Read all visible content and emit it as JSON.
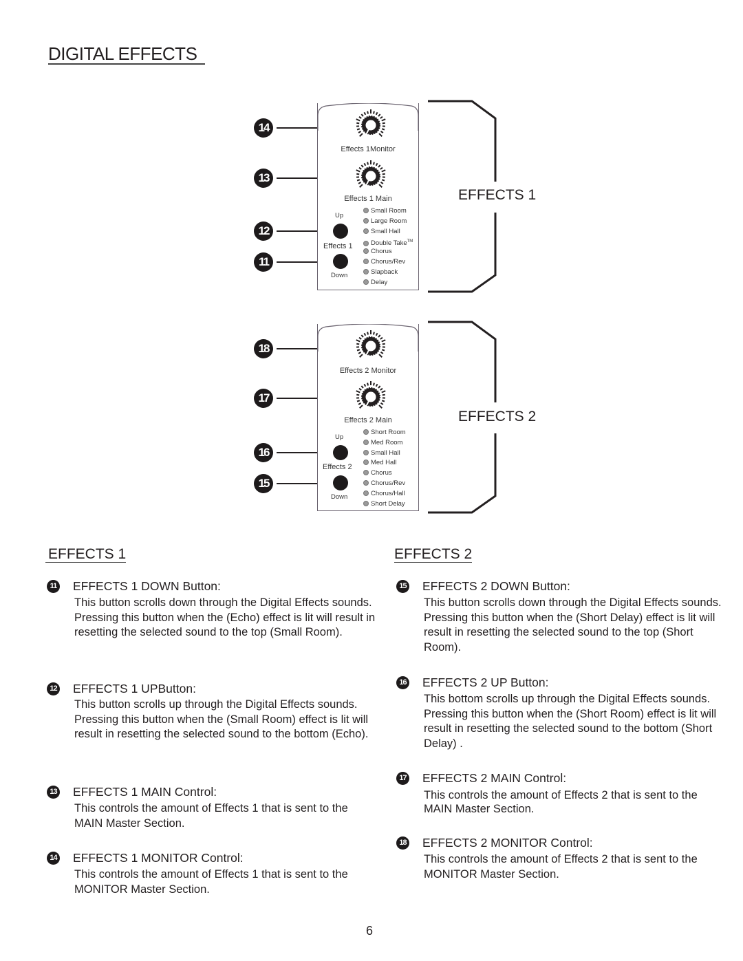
{
  "page": {
    "title": "DIGITAL EFFECTS",
    "page_number": "6"
  },
  "diagram": {
    "effects1": {
      "bracket_label": "EFFECTS 1",
      "monitor_knob_label": "Effects 1Monitor",
      "main_knob_label": "Effects 1 Main",
      "up_label": "Up",
      "down_label": "Down",
      "group_label": "Effects 1",
      "callouts": {
        "monitor": "14",
        "main": "13",
        "up": "12",
        "down": "11"
      },
      "effects": [
        "Small Room",
        "Large Room",
        "Small Hall",
        "Double Take",
        "Chorus",
        "Chorus/Rev",
        "Slapback",
        "Delay"
      ],
      "trademark": "TM"
    },
    "effects2": {
      "bracket_label": "EFFECTS 2",
      "monitor_knob_label": "Effects 2 Monitor",
      "main_knob_label": "Effects 2 Main",
      "up_label": "Up",
      "down_label": "Down",
      "group_label": "Effects 2",
      "callouts": {
        "monitor": "18",
        "main": "17",
        "up": "16",
        "down": "15"
      },
      "effects": [
        "Short Room",
        "Med Room",
        "Small Hall",
        "Med Hall",
        "Chorus",
        "Chorus/Rev",
        "Chorus/Hall",
        "Short Delay"
      ]
    }
  },
  "sections": {
    "effects1": {
      "heading": "EFFECTS 1",
      "items": [
        {
          "num": "11",
          "title": "EFFECTS 1 DOWN Button:",
          "desc": "This button scrolls down through the Digital Effects sounds.  Pressing this button when the (Echo) effect is lit will result in resetting the selected sound to the top (Small Room)."
        },
        {
          "num": "12",
          "title": "EFFECTS 1 UPButton:",
          "desc": "This button scrolls up through the Digital Effects sounds.  Pressing this button when the (Small Room) effect is lit will result in resetting the selected sound to the bottom (Echo)."
        },
        {
          "num": "13",
          "title": "EFFECTS 1 MAIN  Control:",
          "desc": "This controls the amount of Effects 1 that is sent to the MAIN Master Section."
        },
        {
          "num": "14",
          "title": "EFFECTS 1 MONITOR  Control:",
          "desc": "This controls the amount of Effects 1 that is sent to the MONITOR Master Section."
        }
      ]
    },
    "effects2": {
      "heading": "EFFECTS 2",
      "items": [
        {
          "num": "15",
          "title": "EFFECTS 2 DOWN Button:",
          "desc": "This button scrolls down through the Digital Effects sounds.  Pressing this button when the (Short Delay) effect is lit will result in resetting the selected sound to the top (Short Room)."
        },
        {
          "num": "16",
          "title": "EFFECTS 2 UP Button:",
          "desc": "This bottom scrolls up through the Digital Effects sounds.  Pressing this button when the (Short Room) effect is lit will result in resetting the selected sound to the bottom (Short Delay)   ."
        },
        {
          "num": "17",
          "title": "EFFECTS 2 MAIN  Control:",
          "desc": "This controls the amount of Effects 2 that is sent to the MAIN Master Section."
        },
        {
          "num": "18",
          "title": "EFFECTS 2 MONITOR  Control:",
          "desc": "This controls the amount of Effects 2 that is sent to the MONITOR Master Section."
        }
      ]
    }
  }
}
